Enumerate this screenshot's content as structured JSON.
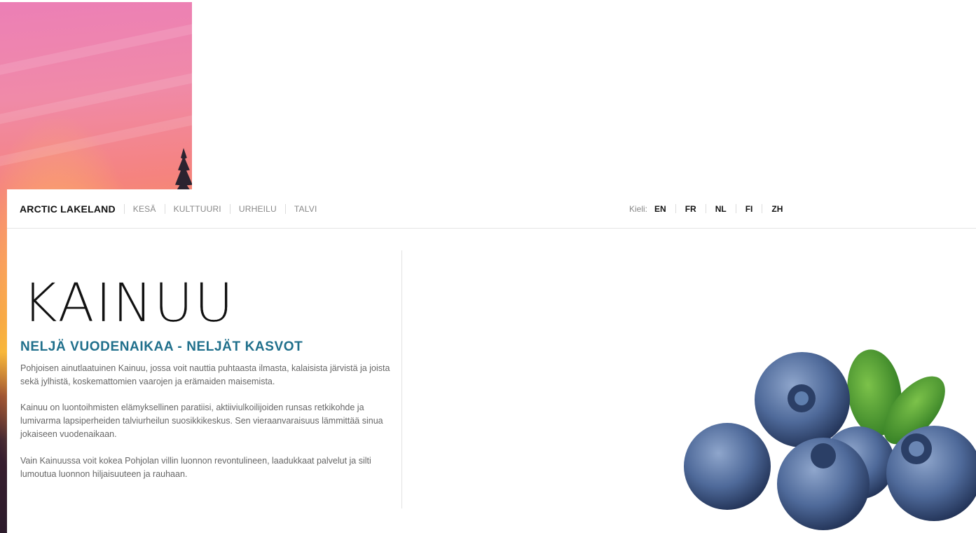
{
  "nav": {
    "brand": "ARCTIC LAKELAND",
    "links": [
      "KESÄ",
      "KULTTUURI",
      "URHEILU",
      "TALVI"
    ]
  },
  "language": {
    "label": "Kieli:",
    "options": [
      "EN",
      "FR",
      "NL",
      "FI",
      "ZH"
    ]
  },
  "hero": {
    "title": "KAINUU",
    "subtitle": "NELJÄ VUODENAIKAA - NELJÄT KASVOT",
    "paragraphs": [
      "Pohjoisen ainutlaatuinen Kainuu, jossa voit nauttia puhtaasta ilmasta, kalaisista järvistä ja joista sekä jylhistä, koskemattomien vaarojen ja erämaiden maisemista.",
      "Kainuu on luontoihmisten elämyksellinen paratiisi, aktiiviulkoilijoiden runsas retkikohde ja lumivarma lapsiperheiden talviurheilun suosikkikeskus. Sen vieraanvaraisuus lämmittää sinua jokaiseen vuodenaikaan.",
      "Vain Kainuussa voit kokea Pohjolan villin luonnon revontulineen, laadukkaat palvelut ja silti lumoutua luonnon hiljaisuuteen ja rauhaan."
    ]
  },
  "colors": {
    "accent": "#1f6f8b",
    "text": "#111111",
    "muted": "#888888"
  }
}
